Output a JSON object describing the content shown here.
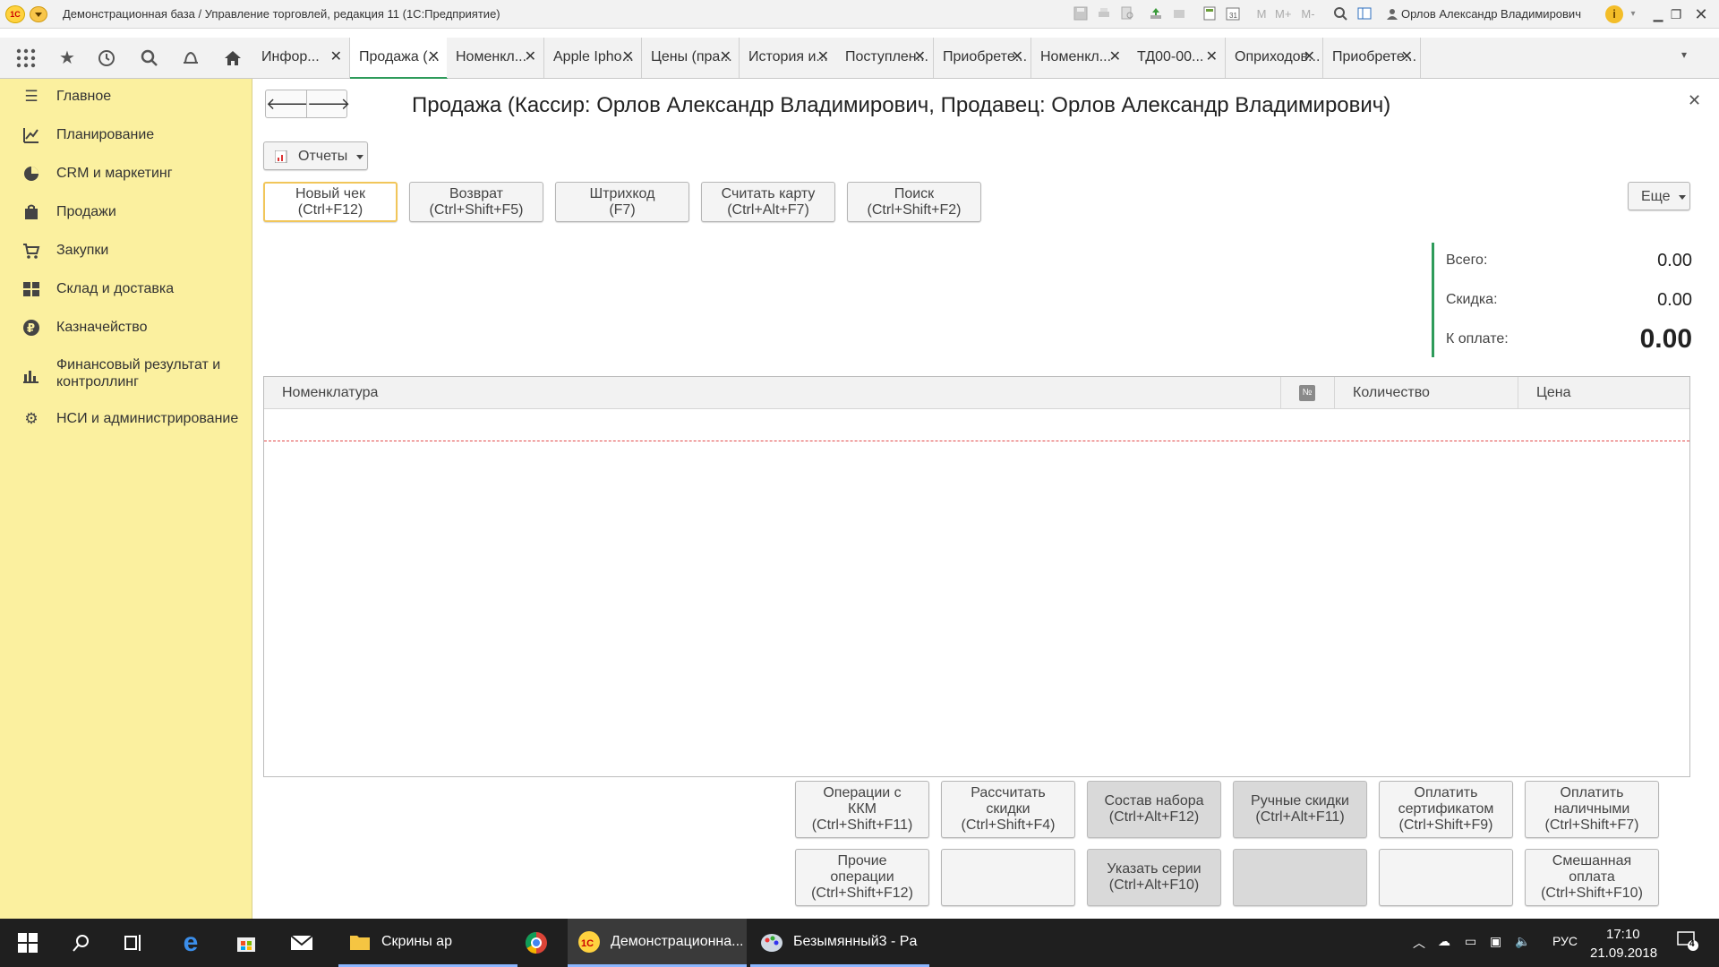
{
  "window": {
    "title": "Демонстрационная база / Управление торговлей, редакция 11  (1С:Предприятие)",
    "user": "Орлов Александр Владимирович",
    "info_icon": "i",
    "logo_text": "1С",
    "m_buttons": [
      "M",
      "M+",
      "M-"
    ]
  },
  "tabs": [
    {
      "label": "Инфор...",
      "active": false
    },
    {
      "label": "Продажа (...",
      "active": true
    },
    {
      "label": "Номенкл...",
      "active": false
    },
    {
      "label": "Apple Ipho...",
      "active": false
    },
    {
      "label": "Цены (пра...",
      "active": false
    },
    {
      "label": "История и...",
      "active": false
    },
    {
      "label": "Поступлен...",
      "active": false
    },
    {
      "label": "Приобрете...",
      "active": false
    },
    {
      "label": "Номенкл...",
      "active": false
    },
    {
      "label": "ТД00-00...",
      "active": false
    },
    {
      "label": "Оприходов...",
      "active": false
    },
    {
      "label": "Приобрете...",
      "active": false
    }
  ],
  "sidebar": {
    "items": [
      {
        "label": "Главное",
        "icon": "menu-lines-icon"
      },
      {
        "label": "Планирование",
        "icon": "chart-icon"
      },
      {
        "label": "CRM и маркетинг",
        "icon": "pie-icon"
      },
      {
        "label": "Продажи",
        "icon": "bag-icon"
      },
      {
        "label": "Закупки",
        "icon": "cart-icon"
      },
      {
        "label": "Склад и доставка",
        "icon": "warehouse-icon"
      },
      {
        "label": "Казначейство",
        "icon": "ruble-icon"
      },
      {
        "label": "Финансовый результат и контроллинг",
        "icon": "bars-icon"
      },
      {
        "label": "НСИ и администрирование",
        "icon": "gear-icon"
      }
    ]
  },
  "document": {
    "title": "Продажа (Кассир: Орлов Александр Владимирович, Продавец: Орлов Александр Владимирович)",
    "reports_label": "Отчеты",
    "more_label": "Еще",
    "top_buttons": [
      {
        "line1": "Новый чек",
        "line2": "(Ctrl+F12)"
      },
      {
        "line1": "Возврат",
        "line2": "(Ctrl+Shift+F5)"
      },
      {
        "line1": "Штрихкод",
        "line2": "(F7)"
      },
      {
        "line1": "Считать карту",
        "line2": "(Ctrl+Alt+F7)"
      },
      {
        "line1": "Поиск",
        "line2": "(Ctrl+Shift+F2)"
      }
    ],
    "totals": {
      "total_label": "Всего:",
      "total_value": "0.00",
      "discount_label": "Скидка:",
      "discount_value": "0.00",
      "topay_label": "К оплате:",
      "topay_value": "0.00"
    },
    "grid": {
      "columns": [
        "Номенклатура",
        "№",
        "Количество",
        "Цена"
      ]
    },
    "bottom_buttons_row1": [
      {
        "lines": [
          "Операции с",
          "ККМ",
          "(Ctrl+Shift+F11)"
        ]
      },
      {
        "lines": [
          "Рассчитать",
          "скидки",
          "(Ctrl+Shift+F4)"
        ]
      },
      {
        "lines": [
          "Состав набора",
          "(Ctrl+Alt+F12)"
        ]
      },
      {
        "lines": [
          "Ручные скидки",
          "(Ctrl+Alt+F11)"
        ]
      },
      {
        "lines": [
          "Оплатить",
          "сертификатом",
          "(Ctrl+Shift+F9)"
        ]
      },
      {
        "lines": [
          "Оплатить",
          "наличными",
          "(Ctrl+Shift+F7)"
        ]
      }
    ],
    "bottom_buttons_row2": [
      {
        "lines": [
          "Прочие",
          "операции",
          "(Ctrl+Shift+F12)"
        ]
      },
      {
        "lines": []
      },
      {
        "lines": [
          "Указать серии",
          "(Ctrl+Alt+F10)"
        ]
      },
      {
        "lines": []
      },
      {
        "lines": []
      },
      {
        "lines": [
          "Смешанная",
          "оплата",
          "(Ctrl+Shift+F10)"
        ]
      }
    ]
  },
  "taskbar": {
    "apps": [
      {
        "label": "Скрины ар"
      },
      {
        "label": "Демонстрационна..."
      },
      {
        "label": "Безымянный3 - Pa"
      }
    ],
    "language": "РУС",
    "time": "17:10",
    "date": "21.09.2018",
    "notification_count": "4"
  }
}
